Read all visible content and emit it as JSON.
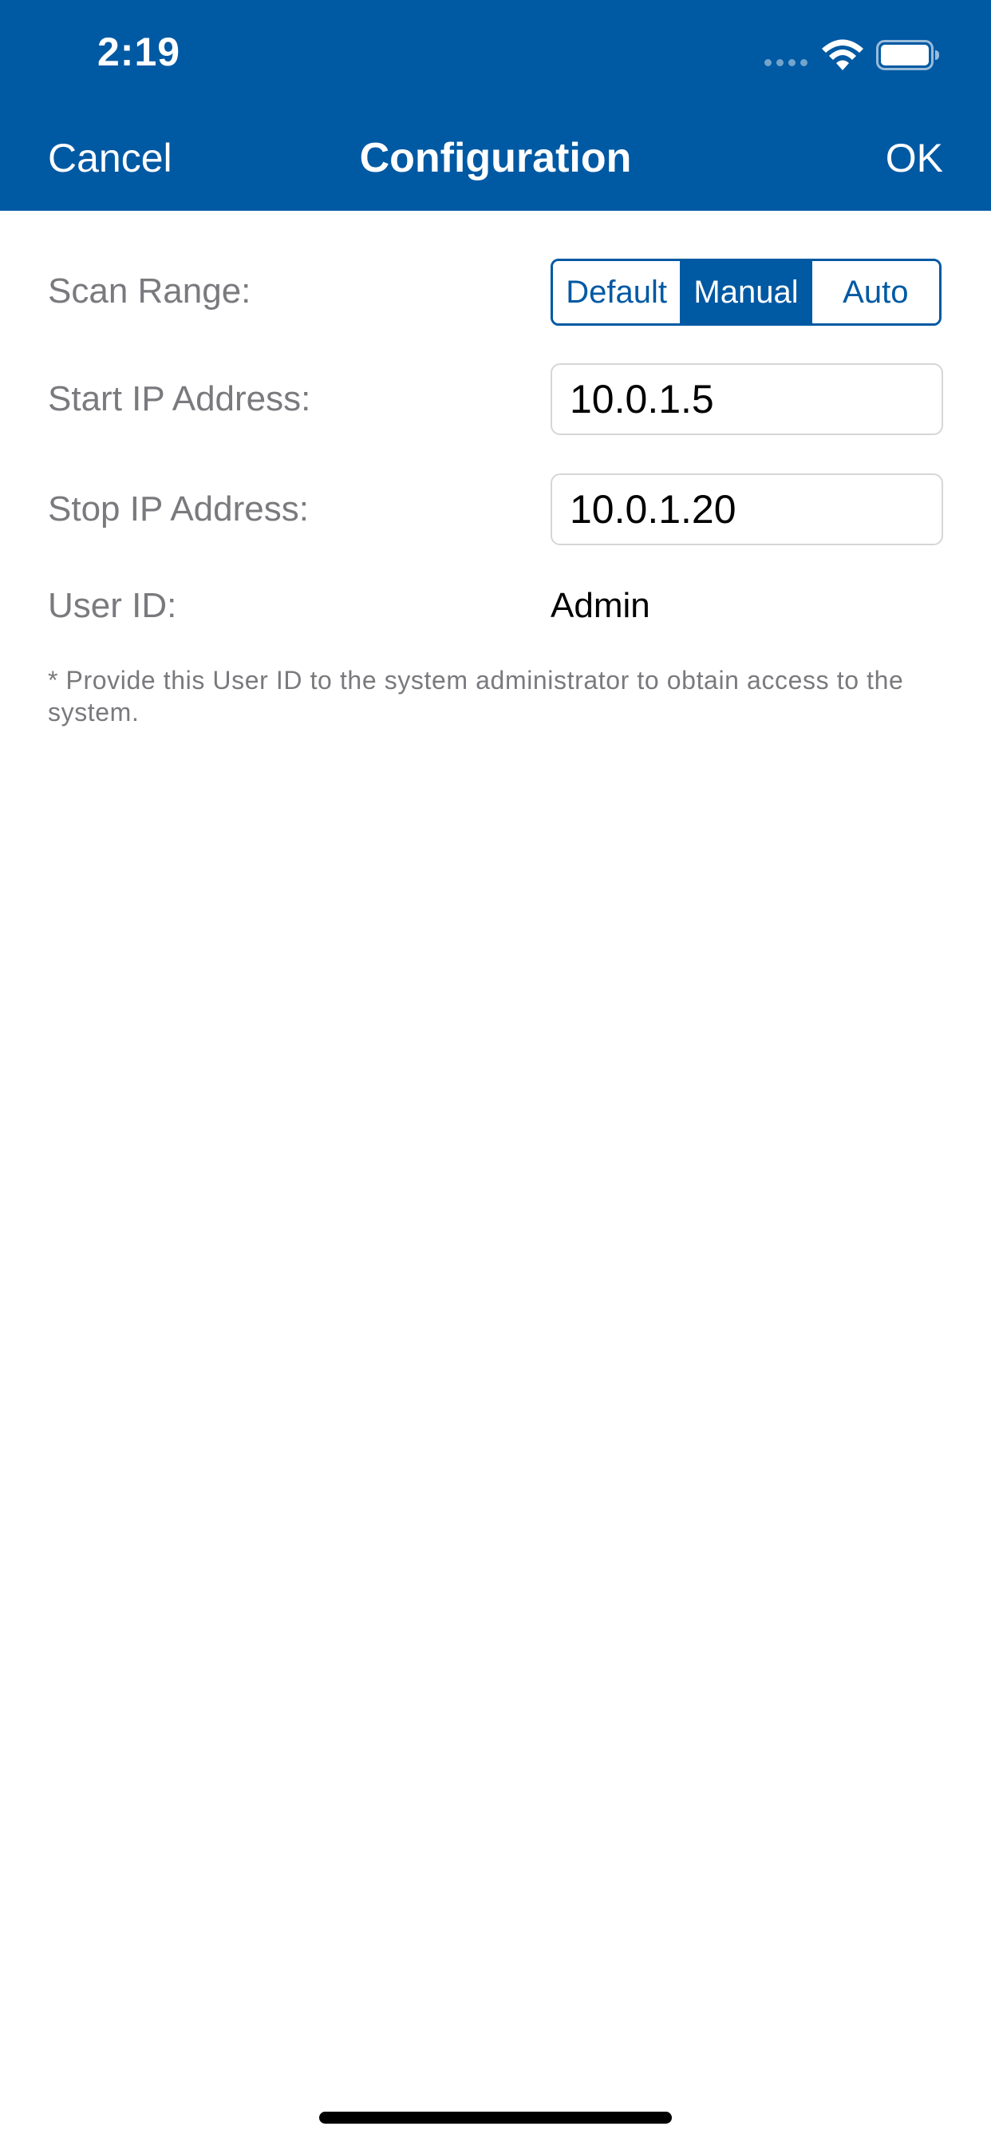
{
  "status_bar": {
    "time": "2:19",
    "icons": [
      "cellular-signal-icon",
      "wifi-icon",
      "battery-icon"
    ]
  },
  "nav_bar": {
    "cancel_label": "Cancel",
    "title": "Configuration",
    "ok_label": "OK"
  },
  "form": {
    "scan_range": {
      "label": "Scan Range:",
      "options": [
        "Default",
        "Manual",
        "Auto"
      ],
      "selected": "Manual"
    },
    "start_ip": {
      "label": "Start IP Address:",
      "value": "10.0.1.5"
    },
    "stop_ip": {
      "label": "Stop IP Address:",
      "value": "10.0.1.20"
    },
    "user_id": {
      "label": "User ID:",
      "value": "Admin"
    },
    "footnote": "* Provide this User ID to the system administrator to obtain access to the system."
  },
  "colors": {
    "brand_blue": "#0059a3",
    "label_gray": "#7a7a7e",
    "background": "#ffffff"
  }
}
